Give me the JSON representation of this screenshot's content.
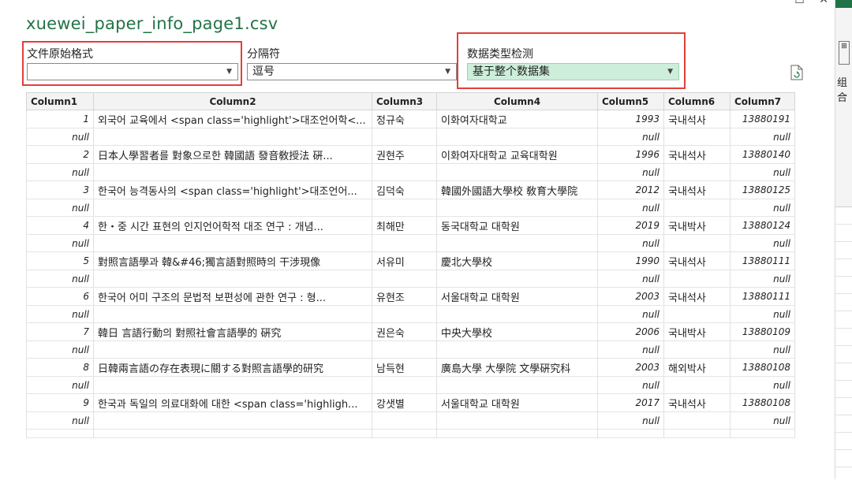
{
  "title": "xuewei_paper_info_page1.csv",
  "controls": {
    "file_origin": {
      "label": "文件原始格式",
      "value": ""
    },
    "delimiter": {
      "label": "分隔符",
      "value": "逗号"
    },
    "type_detection": {
      "label": "数据类型检测",
      "value": "基于整个数据集"
    }
  },
  "side_panel": {
    "group_label": "组合"
  },
  "colors": {
    "title": "#217346",
    "highlight_box": "#e0403a",
    "selected_dropdown": "#cdeeda"
  },
  "icons": [
    "refresh-file-icon",
    "minimize-icon",
    "close-icon",
    "chevron-down-icon"
  ],
  "table": {
    "headers": [
      "Column1",
      "Column2",
      "Column3",
      "Column4",
      "Column5",
      "Column6",
      "Column7"
    ],
    "rows": [
      [
        "1",
        "외국어 교육에서 <span class='highlight'>대조언어학<...",
        "정규숙",
        "이화여자대학교",
        "1993",
        "국내석사",
        "13880191"
      ],
      [
        "null",
        "",
        "",
        "",
        "null",
        "",
        "null"
      ],
      [
        "2",
        "日本人學習者를 對象으로한 韓國語 發音敎授法 硏...",
        "권현주",
        "이화여자대학교 교육대학원",
        "1996",
        "국내석사",
        "13880140"
      ],
      [
        "null",
        "",
        "",
        "",
        "null",
        "",
        "null"
      ],
      [
        "3",
        "한국어 능격동사의 <span class='highlight'>대조언어...",
        "김덕숙",
        "韓國外國語大學校 敎育大學院",
        "2012",
        "국내석사",
        "13880125"
      ],
      [
        "null",
        "",
        "",
        "",
        "null",
        "",
        "null"
      ],
      [
        "4",
        "한・중 시간 표현의 인지언어학적 대조 연구 : 개념...",
        "최해만",
        "동국대학교 대학원",
        "2019",
        "국내박사",
        "13880124"
      ],
      [
        "null",
        "",
        "",
        "",
        "null",
        "",
        "null"
      ],
      [
        "5",
        "對照言語學과 韓&#46;獨言語對照時의 干涉現像",
        "서유미",
        "慶北大學校",
        "1990",
        "국내석사",
        "13880111"
      ],
      [
        "null",
        "",
        "",
        "",
        "null",
        "",
        "null"
      ],
      [
        "6",
        "한국어 어미 구조의 문법적 보편성에 관한 연구 : 형...",
        "유현조",
        "서울대학교 대학원",
        "2003",
        "국내석사",
        "13880111"
      ],
      [
        "null",
        "",
        "",
        "",
        "null",
        "",
        "null"
      ],
      [
        "7",
        "韓日 言語行動의 對照社會言語學的 硏究",
        "권은숙",
        "中央大學校",
        "2006",
        "국내박사",
        "13880109"
      ],
      [
        "null",
        "",
        "",
        "",
        "null",
        "",
        "null"
      ],
      [
        "8",
        "日韓兩言語の存在表現に關する對照言語學的研究",
        "남득현",
        "廣島大學 大學院 文學硏究科",
        "2003",
        "해외박사",
        "13880108"
      ],
      [
        "null",
        "",
        "",
        "",
        "null",
        "",
        "null"
      ],
      [
        "9",
        "한국과 독일의 의료대화에 대한 <span class='highligh...",
        "강샛별",
        "서울대학교 대학원",
        "2017",
        "국내석사",
        "13880108"
      ],
      [
        "null",
        "",
        "",
        "",
        "null",
        "",
        "null"
      ]
    ]
  }
}
